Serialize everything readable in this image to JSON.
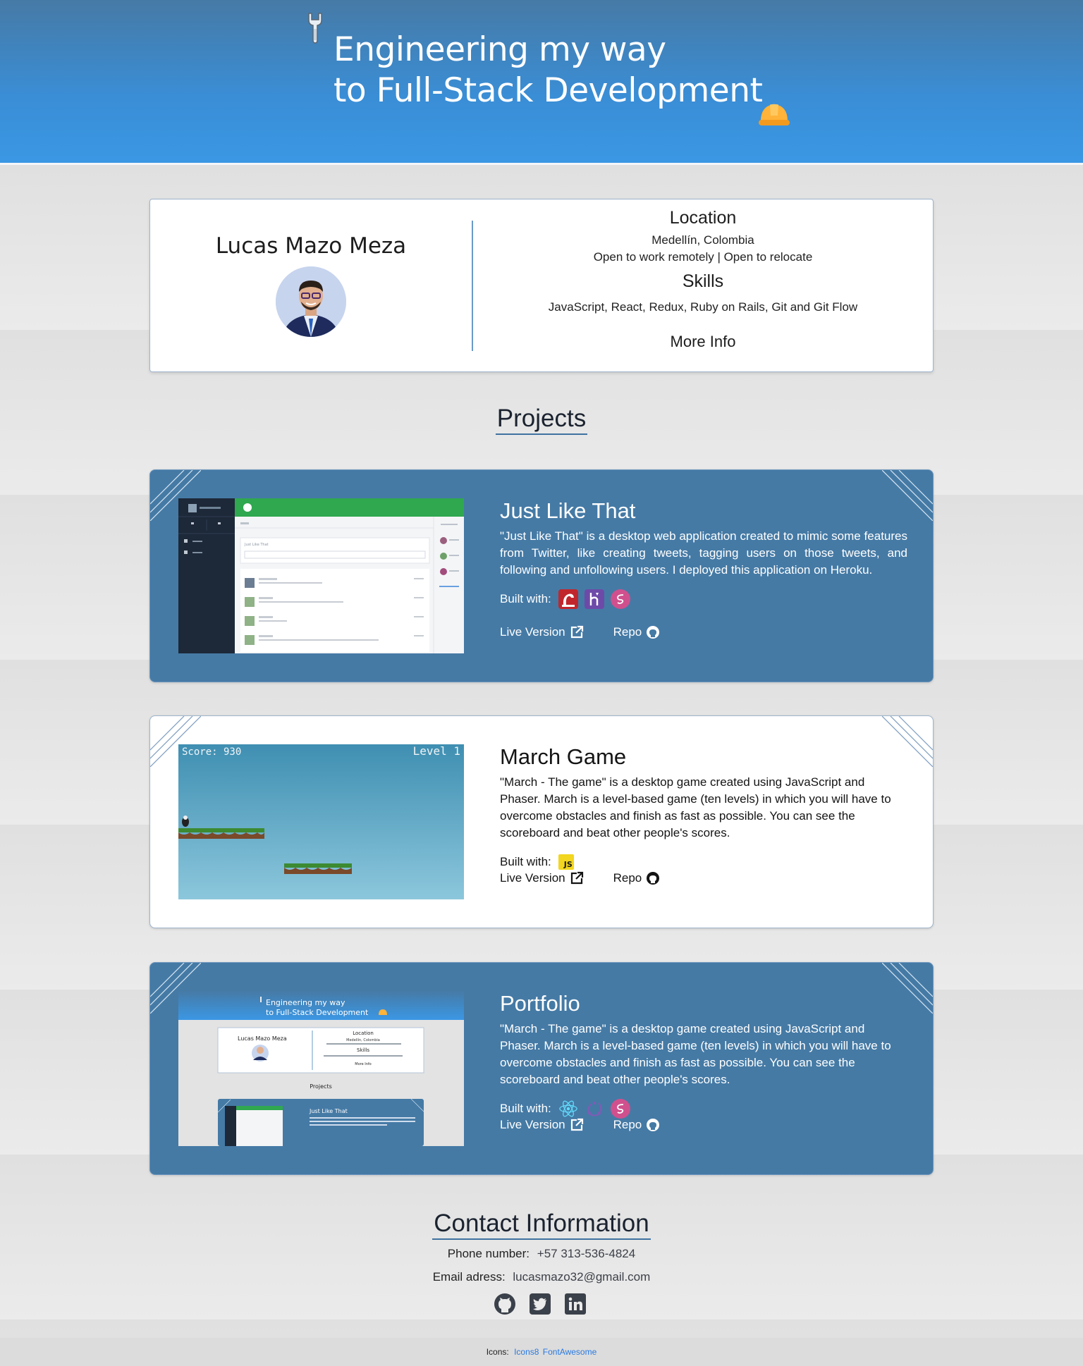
{
  "header": {
    "title_line1": "Engineering my way",
    "title_line2": "to Full-Stack Development"
  },
  "profile": {
    "name": "Lucas Mazo Meza",
    "location_heading": "Location",
    "location": "Medellín, Colombia",
    "availability": "Open to work remotely | Open to relocate",
    "skills_heading": "Skills",
    "skills": "JavaScript, React, Redux, Ruby on Rails, Git and Git Flow",
    "more_info": "More Info"
  },
  "projects_heading": "Projects",
  "projects": [
    {
      "title": "Just Like That",
      "description": "\"Just Like That\" is a desktop web application created to mimic some features from Twitter, like creating tweets, tagging users on those tweets, and following and unfollowing users. I deployed this application on Heroku.",
      "built_with_label": "Built with:",
      "tech_icons": [
        "rails-icon",
        "heroku-icon",
        "sass-icon"
      ],
      "live_label": "Live Version",
      "repo_label": "Repo",
      "theme": "blue"
    },
    {
      "title": "March Game",
      "description": "\"March - The game\" is a desktop game created using JavaScript and Phaser. March is a level-based game (ten levels) in which you will have to overcome obstacles and finish as fast as possible. You can see the scoreboard and beat other people's scores.",
      "built_with_label": "Built with:",
      "tech_icons": [
        "javascript-icon"
      ],
      "live_label": "Live Version",
      "repo_label": "Repo",
      "theme": "white",
      "game_score": "Score: 930",
      "game_level": "Level 1"
    },
    {
      "title": "Portfolio",
      "description": "\"March - The game\" is a desktop game created using JavaScript and Phaser. March is a level-based game (ten levels) in which you will have to overcome obstacles and finish as fast as possible. You can see the scoreboard and beat other people's scores.",
      "built_with_label": "Built with:",
      "tech_icons": [
        "react-icon",
        "redux-icon",
        "sass-icon"
      ],
      "live_label": "Live Version",
      "repo_label": "Repo",
      "theme": "blue"
    }
  ],
  "thumbnails": {
    "jlt_compose_placeholder": "Just Like That",
    "portfolio_title_line1": "Engineering my way",
    "portfolio_title_line2": "to Full-Stack Development",
    "portfolio_name": "Lucas Mazo Meza",
    "portfolio_location": "Location",
    "portfolio_location_value": "Medellín, Colombia",
    "portfolio_skills": "Skills",
    "portfolio_more": "More Info",
    "portfolio_projects": "Projects",
    "portfolio_card_title": "Just Like That"
  },
  "contact": {
    "heading": "Contact Information",
    "phone_label": "Phone number:",
    "phone": "+57 313-536-4824",
    "email_label": "Email adress:",
    "email": "lucasmazo32@gmail.com",
    "social_icons": [
      "github-icon",
      "twitter-icon",
      "linkedin-icon"
    ]
  },
  "footer": {
    "label": "Icons:",
    "link1": "Icons8",
    "link2": "FontAwesome"
  },
  "colors": {
    "header_gradient_top": "#467aa6",
    "header_gradient_bottom": "#3b97e4",
    "card_blue": "#457aa5",
    "accent_line": "#3f72a0",
    "link_blue": "#2a7ae2"
  }
}
